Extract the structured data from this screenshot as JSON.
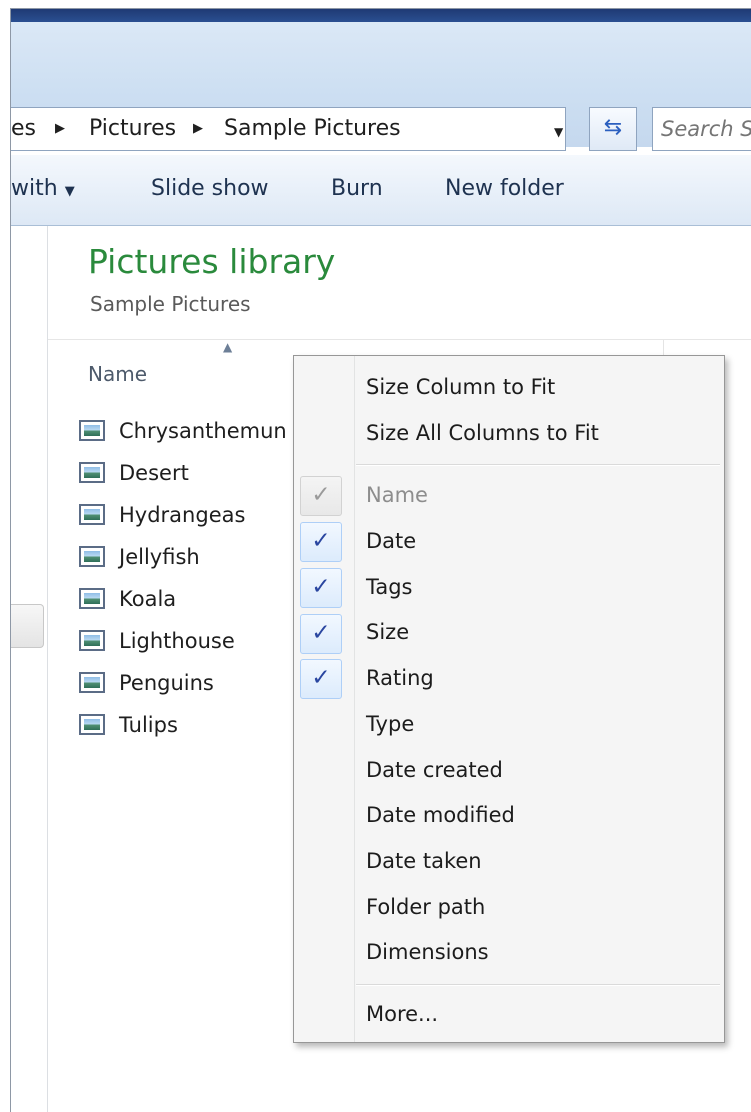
{
  "address_bar": {
    "crumbs": [
      "es",
      "Pictures",
      "Sample Pictures"
    ]
  },
  "search": {
    "placeholder": "Search S"
  },
  "toolbar": {
    "share_with": "with",
    "slide_show": "Slide show",
    "burn": "Burn",
    "new_folder": "New folder"
  },
  "library": {
    "title": "Pictures library",
    "subtitle": "Sample Pictures"
  },
  "columns": {
    "name_header": "Name"
  },
  "files": [
    "Chrysanthemun",
    "Desert",
    "Hydrangeas",
    "Jellyfish",
    "Koala",
    "Lighthouse",
    "Penguins",
    "Tulips"
  ],
  "context_menu": {
    "size_column_to_fit": "Size Column to Fit",
    "size_all_columns_to_fit": "Size All Columns to Fit",
    "columns": [
      {
        "label": "Name",
        "checked": true,
        "disabled": true
      },
      {
        "label": "Date",
        "checked": true,
        "disabled": false
      },
      {
        "label": "Tags",
        "checked": true,
        "disabled": false
      },
      {
        "label": "Size",
        "checked": true,
        "disabled": false
      },
      {
        "label": "Rating",
        "checked": true,
        "disabled": false
      },
      {
        "label": "Type",
        "checked": false,
        "disabled": false
      },
      {
        "label": "Date created",
        "checked": false,
        "disabled": false
      },
      {
        "label": "Date modified",
        "checked": false,
        "disabled": false
      },
      {
        "label": "Date taken",
        "checked": false,
        "disabled": false
      },
      {
        "label": "Folder path",
        "checked": false,
        "disabled": false
      },
      {
        "label": "Dimensions",
        "checked": false,
        "disabled": false
      }
    ],
    "more": "More..."
  },
  "icons": {
    "crumb_arrow": "triangle-right-icon",
    "dropdown": "triangle-down-icon",
    "refresh": "refresh-arrows-icon",
    "check": "check-icon",
    "image_file": "image-file-icon"
  },
  "colors": {
    "library_title": "#2a8a3c",
    "title_strip": "#1f3a74",
    "check_mark": "#2a46a0"
  }
}
